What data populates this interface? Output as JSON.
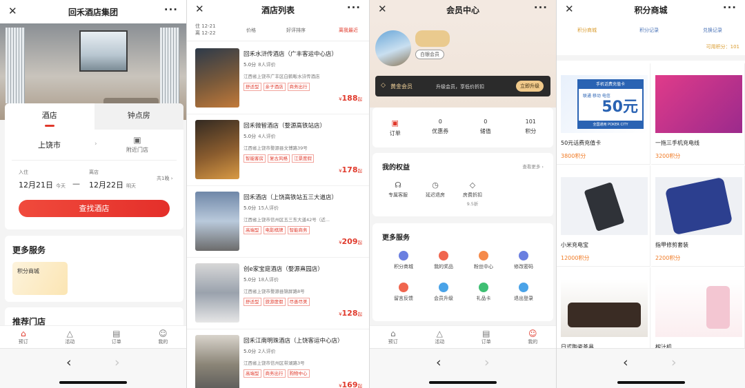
{
  "screens": [
    {
      "title": "回禾酒店集团",
      "close": "✕",
      "more": "···"
    },
    {
      "title": "酒店列表",
      "close": "✕",
      "more": "···"
    },
    {
      "title": "会员中心",
      "close": "✕",
      "more": "···"
    },
    {
      "title": "积分商城",
      "close": "✕",
      "more": "···"
    }
  ],
  "browser": {
    "back": "‹",
    "forward": "›"
  },
  "s1": {
    "tab_hotel": "酒店",
    "tab_hourly": "钟点房",
    "city": "上饶市",
    "nearby": "附近门店",
    "checkin_label": "入住",
    "checkin_date": "12月21日",
    "checkin_day": "今天",
    "checkout_label": "离店",
    "checkout_date": "12月22日",
    "checkout_day": "明天",
    "nights": "共1晚",
    "search_btn": "查找酒店",
    "more_services": "更多服务",
    "points_mall": "积分商城",
    "recommended": "推荐门店"
  },
  "tabbar": {
    "home": "预订",
    "activity": "活动",
    "orders": "订单",
    "mine": "我的"
  },
  "s2": {
    "date_in": "住 12-21",
    "date_out": "离 12-22",
    "price": "价格",
    "rating_sort": "好评排序",
    "nearest": "离我最近",
    "score_unit": "分",
    "hotels": [
      {
        "name": "回禾水浒传酒店（广丰客运中心店）",
        "score": "5.0",
        "reviews": "8人评价",
        "addr": "江西省上饶市广丰区白鹤畈水浒传酒店",
        "tags": [
          "舒适型",
          "亲子酒店",
          "商务出行"
        ],
        "price": "188",
        "cur": "¥",
        "from": "起"
      },
      {
        "name": "回禾微智酒店（婺源高铁站店）",
        "score": "5.0",
        "reviews": "4人评价",
        "addr": "江西省上饶市婺源县文博路39号",
        "tags": [
          "智能客房",
          "复古风格",
          "江景度假"
        ],
        "price": "178",
        "cur": "¥",
        "from": "起"
      },
      {
        "name": "回禾酒店（上饶高铁站五三大道店）",
        "score": "5.0",
        "reviews": "15人评价",
        "addr": "江西省上饶市信州区五三东大道42号（近...",
        "tags": [
          "高端型",
          "电影棋牌",
          "智能商务"
        ],
        "price": "209",
        "cur": "¥",
        "from": "起"
      },
      {
        "name": "创e家宝庭酒店（婺源熹园店）",
        "score": "5.0",
        "reviews": "18人评价",
        "addr": "江西省上饶市婺源县锦屏路8号",
        "tags": [
          "舒适型",
          "旅游度假",
          "尽善尽美"
        ],
        "price": "128",
        "cur": "¥",
        "from": "起"
      },
      {
        "name": "回禾江南明珠酒店（上饶客运中心店）",
        "score": "5.0",
        "reviews": "2人评价",
        "addr": "江西省上饶市信州区带湖路3号",
        "tags": [
          "高端型",
          "商务出行",
          "购物中心"
        ],
        "price": "169",
        "cur": "¥",
        "from": "起"
      }
    ]
  },
  "s3": {
    "level": "白银会员",
    "gold": "黄金会员",
    "upgrade_tip": "升级会员，享低价折扣",
    "upgrade_btn": "立即升级",
    "stats": [
      {
        "value": "",
        "label": "订单"
      },
      {
        "value": "0",
        "label": "优惠券"
      },
      {
        "value": "0",
        "label": "储值"
      },
      {
        "value": "101",
        "label": "积分"
      }
    ],
    "rights_title": "我的权益",
    "rights_more": "查看更多",
    "rights": [
      {
        "label": "专属客服",
        "sub": ""
      },
      {
        "label": "延迟退房",
        "sub": ""
      },
      {
        "label": "房费折扣",
        "sub": "9.5折"
      }
    ],
    "services_title": "更多服务",
    "services": [
      "积分商城",
      "我的奖品",
      "粉丝中心",
      "修改密码",
      "留言反馈",
      "会员升级",
      "礼品卡",
      "退出登录"
    ]
  },
  "s4": {
    "tab_mall": "积分商城",
    "tab_record": "积分记录",
    "tab_redeem": "兑换记录",
    "available": "可用积分：101",
    "banner": {
      "top": "手机话费充值卡",
      "carriers": "联通 移动 电信",
      "value": "50元",
      "tagline": "全国通用 POKER CITY"
    },
    "goods": [
      {
        "name": "50元话费充值卡",
        "price": "3800积分"
      },
      {
        "name": "一拖三手机充电线",
        "price": "3200积分"
      },
      {
        "name": "小米充电宝",
        "price": "12000积分"
      },
      {
        "name": "指甲修剪套装",
        "price": "2200积分"
      },
      {
        "name": "日式陶瓷茶具",
        "price": ""
      },
      {
        "name": "榨汁机",
        "price": ""
      }
    ]
  },
  "colors": {
    "accent": "#e0392b",
    "points": "#f07a24",
    "gold": "#f2d29a"
  }
}
